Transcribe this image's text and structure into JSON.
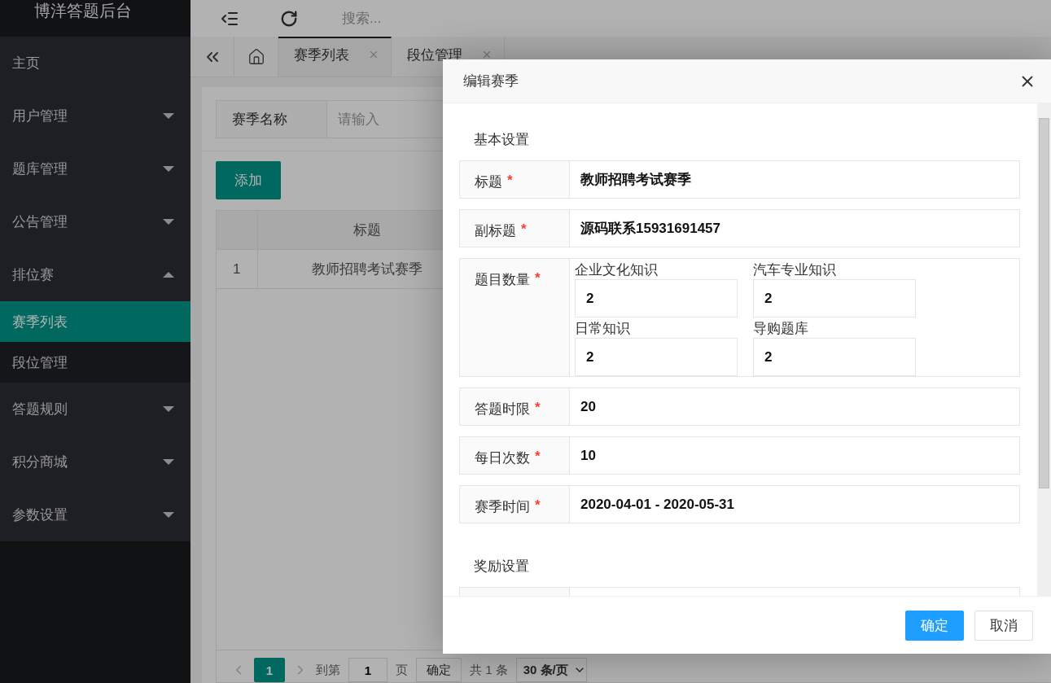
{
  "app_title": "博洋答题后台",
  "header": {
    "search_placeholder": "搜索..."
  },
  "sidebar": {
    "items": [
      {
        "kind": "link",
        "label": "主页",
        "selected": false
      },
      {
        "kind": "group",
        "label": "用户管理",
        "expanded": false,
        "selected": false
      },
      {
        "kind": "group",
        "label": "题库管理",
        "expanded": false,
        "selected": false
      },
      {
        "kind": "group",
        "label": "公告管理",
        "expanded": false,
        "selected": false
      },
      {
        "kind": "group",
        "label": "排位赛",
        "expanded": true,
        "selected": false,
        "children": [
          {
            "label": "赛季列表",
            "selected": true
          },
          {
            "label": "段位管理",
            "selected": false
          }
        ]
      },
      {
        "kind": "group",
        "label": "答题规则",
        "expanded": false,
        "selected": false
      },
      {
        "kind": "group",
        "label": "积分商城",
        "expanded": false,
        "selected": false
      },
      {
        "kind": "group",
        "label": "参数设置",
        "expanded": false,
        "selected": false
      }
    ]
  },
  "tabs": [
    {
      "label": "赛季列表",
      "selected": true
    },
    {
      "label": "段位管理",
      "selected": false
    }
  ],
  "search": {
    "label": "赛季名称",
    "placeholder": "请输入"
  },
  "add_button": "添加",
  "table": {
    "columns": [
      "标题"
    ],
    "rows": [
      {
        "index": "1",
        "title": "教师招聘考试赛季"
      }
    ]
  },
  "pagination": {
    "current": "1",
    "goto_label": "到第",
    "goto_value": "1",
    "page_label": "页",
    "confirm": "确定",
    "total": "共 1 条",
    "page_size": "30 条/页"
  },
  "dialog": {
    "title": "编辑赛季",
    "sections": [
      {
        "heading": "基本设置",
        "fields": [
          {
            "kind": "text",
            "label": "标题",
            "required_mark": "*",
            "value": "教师招聘考试赛季"
          },
          {
            "kind": "text",
            "label": "副标题",
            "required_mark": "*",
            "value": "源码联系15931691457"
          },
          {
            "kind": "counts",
            "label": "题目数量",
            "required_mark": "*",
            "items": [
              {
                "label": "企业文化知识",
                "value": "2"
              },
              {
                "label": "汽车专业知识",
                "value": "2"
              },
              {
                "label": "日常知识",
                "value": "2"
              },
              {
                "label": "导购题库",
                "value": "2"
              }
            ]
          },
          {
            "kind": "text",
            "label": "答题时限",
            "required_mark": "*",
            "value": "20"
          },
          {
            "kind": "text",
            "label": "每日次数",
            "required_mark": "*",
            "value": "10"
          },
          {
            "kind": "text",
            "label": "赛季时间",
            "required_mark": "*",
            "value": "2020-04-01 - 2020-05-31"
          }
        ]
      },
      {
        "heading": "奖励设置"
      }
    ],
    "buttons": [
      {
        "label": "确定",
        "primary": true
      },
      {
        "label": "取消",
        "primary": false
      }
    ]
  }
}
